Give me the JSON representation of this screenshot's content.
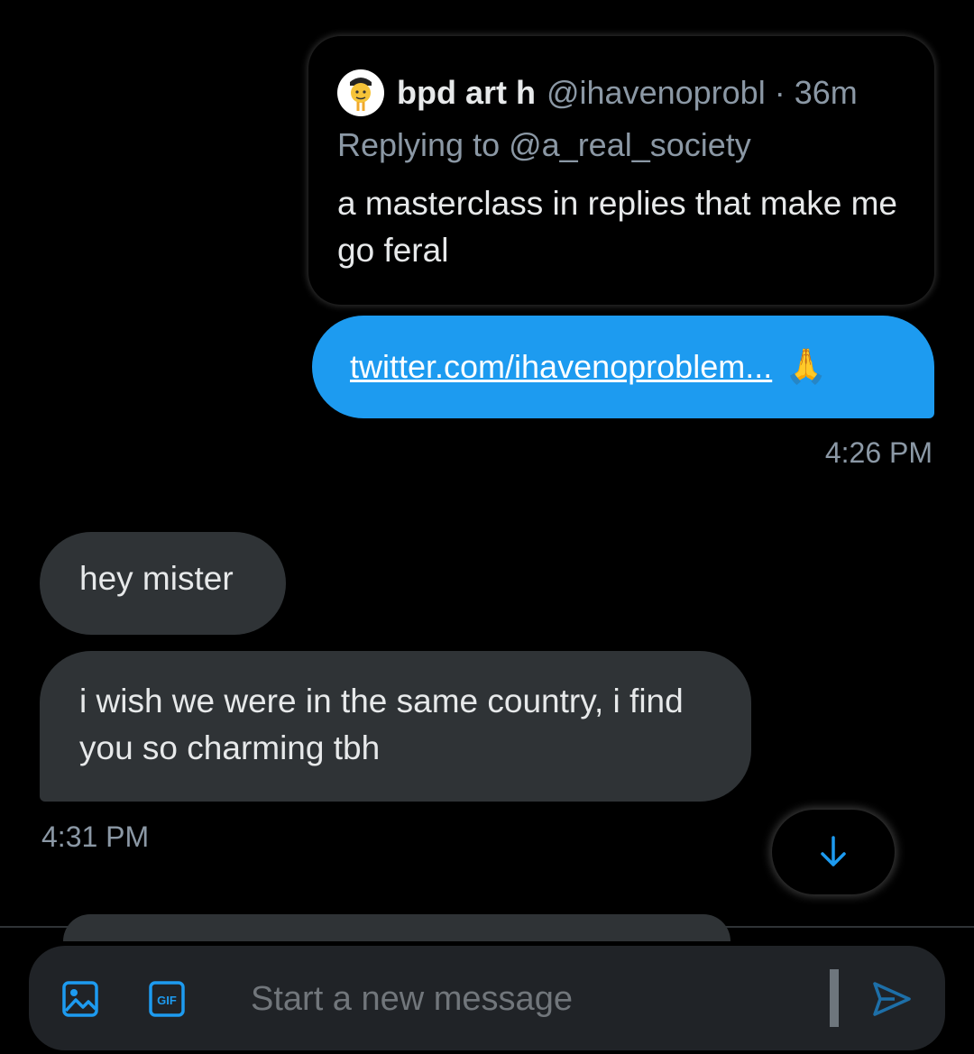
{
  "quoted_tweet": {
    "display_name": "bpd art h",
    "handle": "@ihavenoprobl",
    "separator": "·",
    "time_ago": "36m",
    "replying_to": "Replying to @a_real_society",
    "text": "a masterclass in replies that make me go feral",
    "avatar_icon": "avatar-emoji-icon"
  },
  "messages": [
    {
      "direction": "outgoing",
      "link_text": "twitter.com/ihavenoproblem...",
      "emoji": "🙏",
      "time": "4:26 PM"
    },
    {
      "direction": "incoming",
      "text": "hey mister"
    },
    {
      "direction": "incoming",
      "text": "i wish we were in the same country, i find you so charming tbh",
      "time": "4:31 PM"
    }
  ],
  "scroll_button": {
    "icon": "arrow-down-icon"
  },
  "composer": {
    "placeholder": "Start a new message",
    "value": "",
    "image_icon": "image-icon",
    "gif_icon": "gif-icon",
    "gif_label": "GIF",
    "send_icon": "send-icon"
  },
  "colors": {
    "background": "#000000",
    "accent": "#1d9bf0",
    "incoming_bubble": "#2f3336",
    "secondary_text": "#8b98a5",
    "composer_bg": "#202327"
  }
}
